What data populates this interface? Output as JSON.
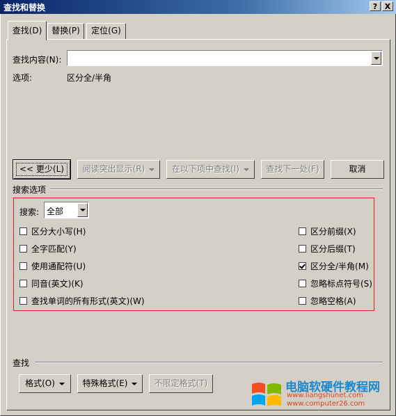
{
  "window": {
    "title": "查找和替换",
    "help_btn": "?",
    "close_btn": "X"
  },
  "tabs": [
    {
      "label": "查找(D)",
      "active": true
    },
    {
      "label": "替换(P)",
      "active": false
    },
    {
      "label": "定位(G)",
      "active": false
    }
  ],
  "find": {
    "label": "查找内容(N):",
    "value": ""
  },
  "options": {
    "label": "选项:",
    "value": "区分全/半角"
  },
  "buttons": {
    "less": "<< 更少(L)",
    "reading_highlight": "阅读突出显示(R)",
    "find_in": "在以下项中查找(I)",
    "find_next": "查找下一处(F)",
    "cancel": "取消"
  },
  "search_options": {
    "section_label": "搜索选项",
    "search_label": "搜索:",
    "search_value": "全部",
    "left_checks": [
      {
        "label": "区分大小写(H)",
        "checked": false
      },
      {
        "label": "全字匹配(Y)",
        "checked": false
      },
      {
        "label": "使用通配符(U)",
        "checked": false
      },
      {
        "label": "同音(英文)(K)",
        "checked": false
      },
      {
        "label": "查找单词的所有形式(英文)(W)",
        "checked": false
      }
    ],
    "right_checks": [
      {
        "label": "区分前缀(X)",
        "checked": false
      },
      {
        "label": "区分后缀(T)",
        "checked": false
      },
      {
        "label": "区分全/半角(M)",
        "checked": true
      },
      {
        "label": "忽略标点符号(S)",
        "checked": false
      },
      {
        "label": "忽略空格(A)",
        "checked": false
      }
    ]
  },
  "find_section": {
    "label": "查找",
    "format": "格式(O)",
    "special": "特殊格式(E)",
    "no_format": "不限定格式(T)"
  },
  "watermark": {
    "site_name": "电脑软硬件教程网",
    "url1": "www.liangshunet.com",
    "url2": "www.computer26.com",
    "colors": {
      "red": "#f25022",
      "green": "#7fba00",
      "blue": "#00a4ef",
      "yellow": "#ffb900"
    }
  }
}
